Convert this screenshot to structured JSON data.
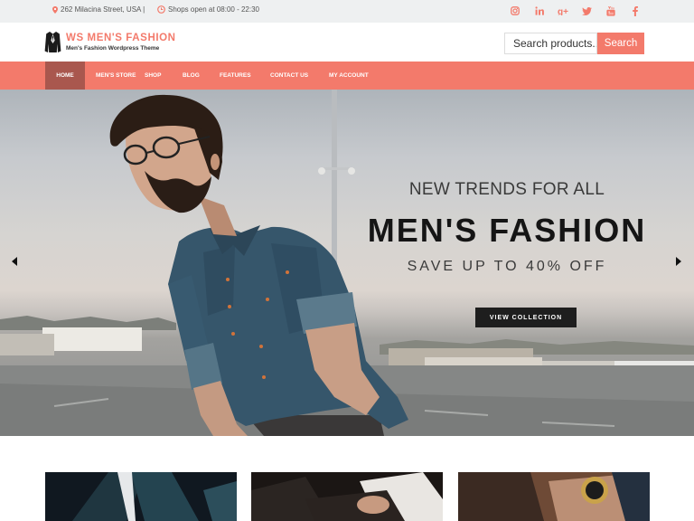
{
  "topbar": {
    "address": "262 Milacina Street, USA |",
    "hours": "Shops open at 08:00 - 22:30",
    "icons": [
      "map-pin-icon",
      "clock-icon"
    ],
    "social": [
      "instagram-icon",
      "linkedin-icon",
      "google-plus-icon",
      "twitter-icon",
      "youtube-icon",
      "facebook-icon"
    ]
  },
  "header": {
    "logo_icon": "jacket-icon",
    "title": "WS MEN'S FASHION",
    "tagline": "Men's Fashion Wordpress Theme",
    "search_placeholder": "Search products...",
    "search_button": "Search"
  },
  "nav": {
    "items": [
      {
        "label": "HOME",
        "active": true
      },
      {
        "label": "MEN'S STORE",
        "active": false
      },
      {
        "label": "SHOP",
        "active": false
      },
      {
        "label": "BLOG",
        "active": false
      },
      {
        "label": "FEATURES",
        "active": false
      },
      {
        "label": "CONTACT US",
        "active": false
      },
      {
        "label": "MY ACCOUNT",
        "active": false
      }
    ]
  },
  "hero": {
    "subtitle": "NEW TRENDS FOR ALL",
    "title": "MEN'S FASHION",
    "save": "SAVE UP TO 40% OFF",
    "button": "VIEW COLLECTION",
    "prev_icon": "arrow-left-icon",
    "next_icon": "arrow-right-icon"
  },
  "colors": {
    "accent": "#f37a6b",
    "nav_active": "#a9574e",
    "topbar_bg": "#eef0f1"
  }
}
